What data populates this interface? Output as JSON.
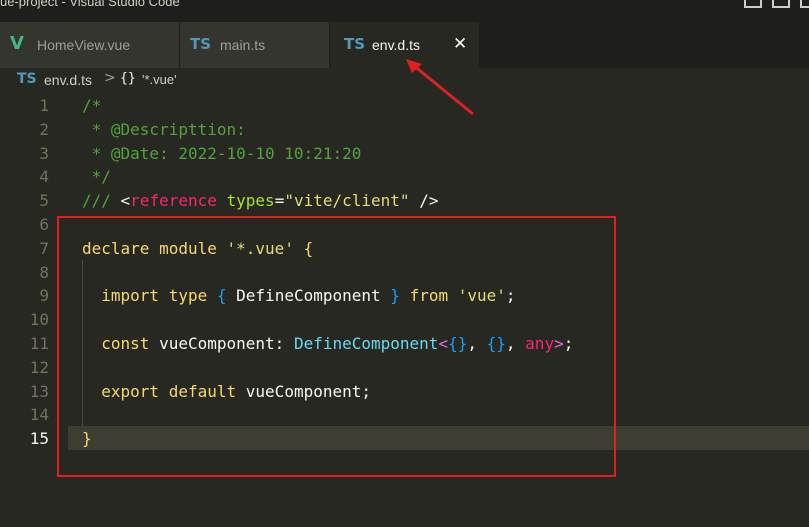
{
  "window": {
    "title": "ue-project - Visual Studio Code"
  },
  "tabs": [
    {
      "icon": "V",
      "icon_name": "vue-icon",
      "label": "HomeView.vue"
    },
    {
      "icon": "TS",
      "icon_name": "typescript-icon",
      "label": "main.ts"
    },
    {
      "icon": "TS",
      "icon_name": "typescript-icon",
      "label": "env.d.ts",
      "active": true,
      "close": "✕"
    }
  ],
  "breadcrumb": {
    "icon": "TS",
    "file": "env.d.ts",
    "separator": ">",
    "symbol": "{}",
    "module": "'*.vue'"
  },
  "editor": {
    "current_line": 15,
    "lines": [
      {
        "n": "1",
        "text": "/*"
      },
      {
        "n": "2",
        "text": " * @Descripttion:"
      },
      {
        "n": "3",
        "text": " * @Date: 2022-10-10 10:21:20"
      },
      {
        "n": "4",
        "text": " */"
      },
      {
        "n": "5",
        "text": "/// <reference types=\"vite/client\" />"
      },
      {
        "n": "6",
        "text": ""
      },
      {
        "n": "7",
        "text": "declare module '*.vue' {"
      },
      {
        "n": "8",
        "text": ""
      },
      {
        "n": "9",
        "text": "  import type { DefineComponent } from 'vue';"
      },
      {
        "n": "10",
        "text": ""
      },
      {
        "n": "11",
        "text": "  const vueComponent: DefineComponent<{}, {}, any>;"
      },
      {
        "n": "12",
        "text": ""
      },
      {
        "n": "13",
        "text": "  export default vueComponent;"
      },
      {
        "n": "14",
        "text": ""
      },
      {
        "n": "15",
        "text": "}"
      }
    ]
  },
  "colors": {
    "background": "#272822",
    "comment": "#52a33b",
    "annotation": "#e02020",
    "ts_icon": "#519aba",
    "vue_icon": "#41b883"
  }
}
